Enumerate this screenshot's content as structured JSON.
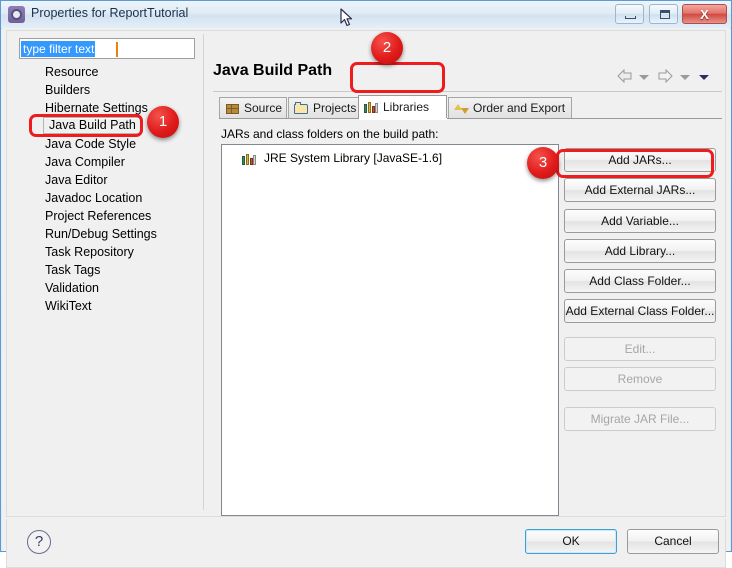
{
  "window": {
    "title": "Properties for ReportTutorial",
    "icon": "gear-icon",
    "controls": {
      "minimize": "—",
      "maximize": "□",
      "close": "X"
    }
  },
  "sidebar": {
    "filter": {
      "value": "type filter text",
      "placeholder": "type filter text"
    },
    "items": [
      {
        "label": "Resource",
        "selected": false
      },
      {
        "label": "Builders",
        "selected": false
      },
      {
        "label": "Hibernate Settings",
        "selected": false
      },
      {
        "label": "Java Build Path",
        "selected": true
      },
      {
        "label": "Java Code Style",
        "selected": false
      },
      {
        "label": "Java Compiler",
        "selected": false
      },
      {
        "label": "Java Editor",
        "selected": false
      },
      {
        "label": "Javadoc Location",
        "selected": false
      },
      {
        "label": "Project References",
        "selected": false
      },
      {
        "label": "Run/Debug Settings",
        "selected": false
      },
      {
        "label": "Task Repository",
        "selected": false
      },
      {
        "label": "Task Tags",
        "selected": false
      },
      {
        "label": "Validation",
        "selected": false
      },
      {
        "label": "WikiText",
        "selected": false
      }
    ]
  },
  "page": {
    "title": "Java Build Path",
    "nav": {
      "back": "back-arrow",
      "forward": "forward-arrow",
      "menu": "dropdown-caret"
    },
    "tabs": [
      {
        "label": "Source",
        "icon": "package-icon",
        "active": false
      },
      {
        "label": "Projects",
        "icon": "folder-icon",
        "active": false
      },
      {
        "label": "Libraries",
        "icon": "books-icon",
        "active": true
      },
      {
        "label": "Order and Export",
        "icon": "order-arrows-icon",
        "active": false
      }
    ],
    "group_label": "JARs and class folders on the build path:",
    "tree": [
      {
        "label": "JRE System Library [JavaSE-1.6]",
        "icon": "books-icon"
      }
    ],
    "buttons": [
      {
        "label": "Add JARs...",
        "enabled": true
      },
      {
        "label": "Add External JARs...",
        "enabled": true
      },
      {
        "label": "Add Variable...",
        "enabled": true
      },
      {
        "label": "Add Library...",
        "enabled": true
      },
      {
        "label": "Add Class Folder...",
        "enabled": true
      },
      {
        "label": "Add External Class Folder...",
        "enabled": true
      },
      {
        "label": "Edit...",
        "enabled": false
      },
      {
        "label": "Remove",
        "enabled": false
      },
      {
        "label": "Migrate JAR File...",
        "enabled": false
      }
    ]
  },
  "footer": {
    "help": "?",
    "ok": "OK",
    "cancel": "Cancel"
  },
  "annotations": {
    "accent_color": "#ee1c1c",
    "badges": [
      {
        "number": "1",
        "target": "Java Build Path"
      },
      {
        "number": "2",
        "target": "Libraries"
      },
      {
        "number": "3",
        "target": "Add External JARs..."
      }
    ]
  }
}
